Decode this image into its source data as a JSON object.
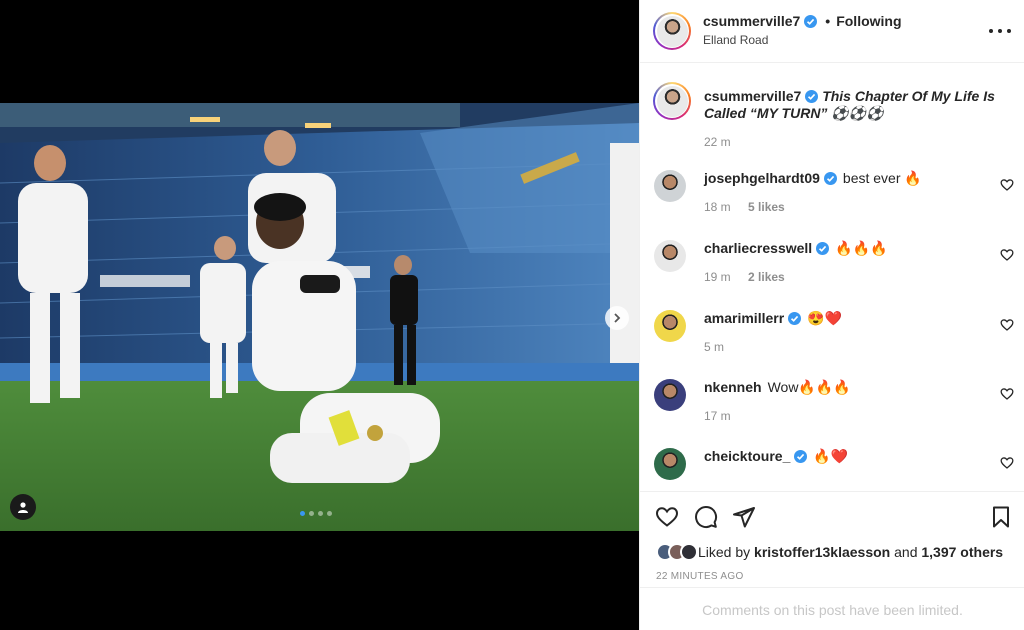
{
  "colors": {
    "verified": "#3897f0",
    "fire": "#ff6a00",
    "heart_red": "#e8263b"
  },
  "post": {
    "media_icons": {
      "next": "chevron-right-icon",
      "tag": "user-tag-icon"
    },
    "carousel": {
      "count": 4,
      "active_index": 0
    }
  },
  "header": {
    "username": "csummerville7",
    "separator": "•",
    "follow_label": "Following",
    "location": "Elland Road"
  },
  "caption": {
    "username": "csummerville7",
    "text": "This Chapter Of My Life Is Called “MY TURN” ⚽️⚽️⚽️",
    "time": "22 m"
  },
  "comments": [
    {
      "username": "josephgelhardt09",
      "verified": true,
      "text": "best ever 🔥",
      "time": "18 m",
      "likes": "5 likes"
    },
    {
      "username": "charliecresswell",
      "verified": true,
      "text": "🔥🔥🔥",
      "time": "19 m",
      "likes": "2 likes"
    },
    {
      "username": "amarimillerr",
      "verified": true,
      "text": "😍❤️",
      "time": "5 m",
      "likes": ""
    },
    {
      "username": "nkenneh",
      "verified": false,
      "text": "Wow🔥🔥🔥",
      "time": "17 m",
      "likes": ""
    },
    {
      "username": "cheicktoure_",
      "verified": true,
      "text": "🔥❤️",
      "time": "",
      "likes": ""
    }
  ],
  "actions": {
    "icons": [
      "heart-icon",
      "comment-icon",
      "share-icon",
      "bookmark-icon"
    ],
    "liked_by_prefix": "Liked by",
    "liked_by_user": "kristoffer13klaesson",
    "liked_by_and": "and",
    "liked_by_others": "1,397 others",
    "post_time": "22 MINUTES AGO",
    "limited_notice": "Comments on this post have been limited."
  }
}
